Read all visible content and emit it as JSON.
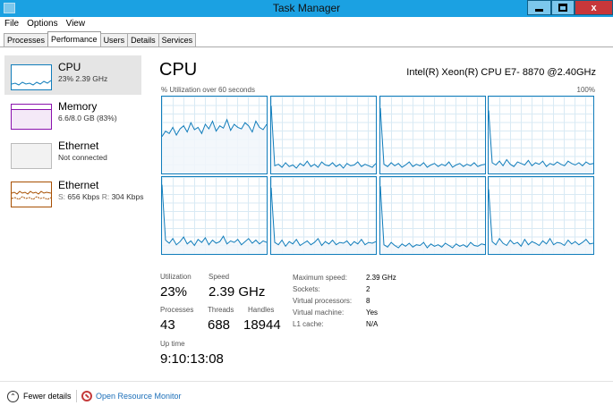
{
  "window": {
    "title": "Task Manager",
    "minimize_label": "",
    "maximize_label": "",
    "close_label": "x"
  },
  "menu": [
    "File",
    "Options",
    "View"
  ],
  "tabs": [
    {
      "label": "Processes",
      "active": false
    },
    {
      "label": "Performance",
      "active": true
    },
    {
      "label": "Users",
      "active": false
    },
    {
      "label": "Details",
      "active": false
    },
    {
      "label": "Services",
      "active": false
    }
  ],
  "sidebar": {
    "items": [
      {
        "name": "CPU",
        "sub": "23%  2.39 GHz",
        "color": "#117dbb",
        "selected": true
      },
      {
        "name": "Memory",
        "sub": "6.6/8.0 GB (83%)",
        "color": "#8b12ae",
        "selected": false
      },
      {
        "name": "Ethernet",
        "sub": "Not connected",
        "color": "#999999",
        "selected": false
      },
      {
        "name": "Ethernet",
        "sub_s_label": "S:",
        "sub_s_value": "656 Kbps",
        "sub_r_label": "R:",
        "sub_r_value": "304 Kbps",
        "color": "#a74f01",
        "selected": false
      }
    ]
  },
  "main": {
    "title": "CPU",
    "cpu_model": "Intel(R) Xeon(R) CPU E7- 8870 @2.40GHz",
    "util_label": "% Utilization over 60 seconds",
    "util_max": "100%",
    "graph_color": "#117dbb",
    "graph_fill": "#f1f6fa"
  },
  "chart_data": {
    "type": "line",
    "ylim": [
      0,
      100
    ],
    "series": [
      {
        "values": [
          48,
          55,
          52,
          60,
          50,
          58,
          62,
          54,
          66,
          57,
          60,
          52,
          64,
          58,
          68,
          55,
          62,
          59,
          70,
          56,
          64,
          60,
          58,
          66,
          62,
          54,
          68,
          60,
          57,
          64
        ]
      },
      {
        "values": [
          88,
          10,
          12,
          8,
          14,
          9,
          11,
          7,
          13,
          10,
          16,
          9,
          12,
          8,
          15,
          11,
          10,
          14,
          9,
          12,
          7,
          13,
          10,
          11,
          15,
          9,
          12,
          10,
          8,
          13
        ]
      },
      {
        "values": [
          85,
          12,
          9,
          14,
          10,
          13,
          8,
          11,
          15,
          9,
          12,
          10,
          14,
          8,
          11,
          13,
          9,
          12,
          10,
          15,
          8,
          11,
          13,
          9,
          12,
          10,
          14,
          9,
          11,
          12
        ]
      },
      {
        "values": [
          82,
          14,
          11,
          16,
          10,
          18,
          12,
          9,
          15,
          13,
          11,
          17,
          10,
          14,
          12,
          16,
          9,
          13,
          11,
          15,
          12,
          10,
          16,
          13,
          11,
          14,
          10,
          15,
          12,
          13
        ]
      },
      {
        "values": [
          90,
          18,
          14,
          20,
          12,
          16,
          22,
          13,
          17,
          11,
          19,
          15,
          21,
          12,
          18,
          14,
          16,
          23,
          13,
          17,
          15,
          19,
          12,
          16,
          20,
          14,
          18,
          13,
          17,
          15
        ]
      },
      {
        "values": [
          86,
          15,
          12,
          18,
          10,
          16,
          13,
          19,
          11,
          14,
          17,
          12,
          15,
          20,
          11,
          16,
          13,
          18,
          12,
          15,
          14,
          17,
          11,
          16,
          13,
          19,
          12,
          15,
          14,
          16
        ]
      },
      {
        "values": [
          88,
          12,
          9,
          15,
          11,
          8,
          13,
          10,
          14,
          9,
          12,
          11,
          15,
          8,
          13,
          10,
          12,
          9,
          14,
          11,
          8,
          13,
          10,
          12,
          9,
          15,
          11,
          10,
          13,
          12
        ]
      },
      {
        "values": [
          84,
          16,
          12,
          20,
          14,
          11,
          18,
          13,
          15,
          10,
          19,
          12,
          16,
          14,
          11,
          17,
          13,
          20,
          12,
          15,
          14,
          11,
          18,
          13,
          16,
          12,
          15,
          19,
          13,
          14
        ]
      }
    ]
  },
  "stats": {
    "utilization_label": "Utilization",
    "utilization_value": "23%",
    "speed_label": "Speed",
    "speed_value": "2.39 GHz",
    "processes_label": "Processes",
    "processes_value": "43",
    "threads_label": "Threads",
    "threads_value": "688",
    "handles_label": "Handles",
    "handles_value": "18944",
    "uptime_label": "Up time",
    "uptime_value": "9:10:13:08"
  },
  "details": [
    {
      "label": "Maximum speed:",
      "value": "2.39 GHz"
    },
    {
      "label": "Sockets:",
      "value": "2"
    },
    {
      "label": "Virtual processors:",
      "value": "8"
    },
    {
      "label": "Virtual machine:",
      "value": "Yes"
    },
    {
      "label": "L1 cache:",
      "value": "N/A"
    }
  ],
  "footer": {
    "fewer_details": "Fewer details",
    "open_monitor": "Open Resource Monitor"
  }
}
